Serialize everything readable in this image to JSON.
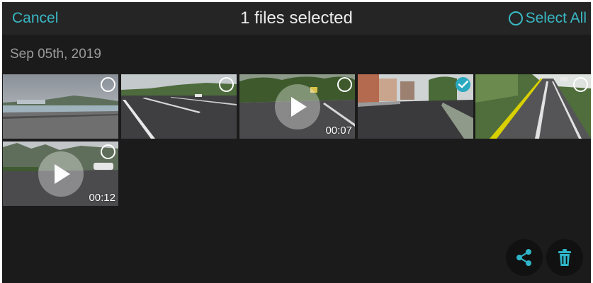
{
  "header": {
    "cancel_label": "Cancel",
    "title": "1 files selected",
    "select_all_label": "Select All"
  },
  "gallery": {
    "date_label": "Sep 05th, 2019",
    "items": [
      {
        "kind": "photo",
        "selected": false,
        "duration": ""
      },
      {
        "kind": "photo",
        "selected": false,
        "duration": ""
      },
      {
        "kind": "video",
        "selected": false,
        "duration": "00:07"
      },
      {
        "kind": "photo",
        "selected": true,
        "duration": ""
      },
      {
        "kind": "photo",
        "selected": false,
        "duration": ""
      },
      {
        "kind": "video",
        "selected": false,
        "duration": "00:12"
      }
    ]
  },
  "actions": {
    "share_icon": "share-icon",
    "delete_icon": "trash-icon"
  },
  "colors": {
    "accent": "#3ab8c4",
    "check_selected": "#2aa9c0",
    "background": "#1b1b1b",
    "header_bg": "#252525"
  }
}
